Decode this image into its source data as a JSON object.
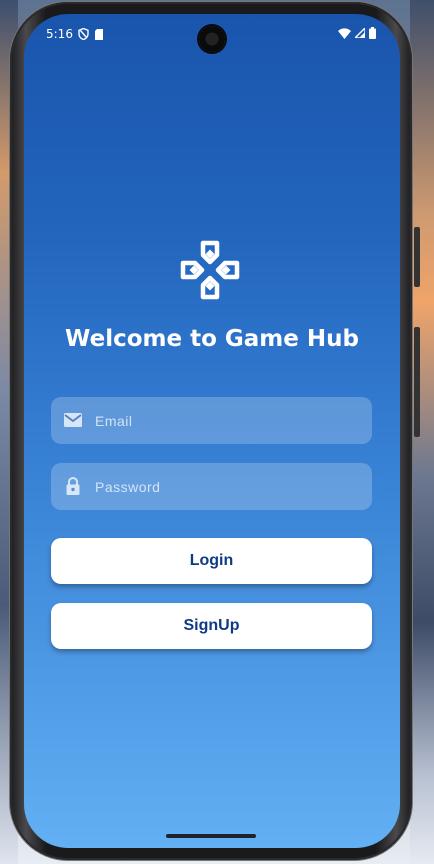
{
  "status": {
    "time": "5:16",
    "left_icons": [
      "shield-icon",
      "sd-card-icon"
    ],
    "right_icons": [
      "wifi-icon",
      "signal-icon",
      "battery-icon"
    ]
  },
  "app": {
    "logo_icon": "gamepad-icon",
    "title": "Welcome to Game Hub"
  },
  "form": {
    "email": {
      "placeholder": "Email",
      "value": "",
      "icon": "mail-icon"
    },
    "password": {
      "placeholder": "Password",
      "value": "",
      "icon": "lock-icon"
    },
    "login_label": "Login",
    "signup_label": "SignUp"
  },
  "colors": {
    "gradient_top": "#1a55ad",
    "gradient_bottom": "#63b0f4",
    "button_text": "#0e3b84",
    "button_bg": "#ffffff"
  }
}
